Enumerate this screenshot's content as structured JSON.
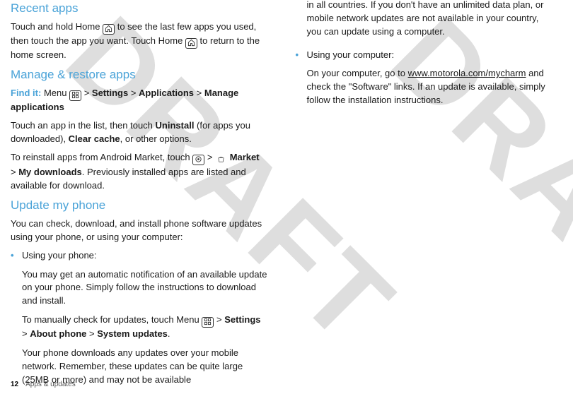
{
  "watermark": "DRAFT",
  "col1": {
    "h_recent": "Recent apps",
    "recent_p1a": "Touch and hold Home ",
    "recent_p1b": " to see the last few apps you used, then touch the app you want. Touch Home ",
    "recent_p1c": " to  return to the home screen.",
    "h_manage": "Manage & restore apps",
    "findit": "Find it:",
    "manage_p1a": " Menu ",
    "manage_p1b": " > ",
    "settings": "Settings",
    "gt": " > ",
    "applications": "Applications",
    "manage_apps": "Manage applications",
    "manage_p2a": "Touch an app in the list, then touch ",
    "uninstall": "Uninstall",
    "manage_p2b": " (for apps you downloaded), ",
    "clearcache": "Clear cache",
    "manage_p2c": ", or other options.",
    "manage_p3a": "To reinstall apps from Android Market, touch ",
    "manage_p3b": " > ",
    "market": "Market",
    "mydownloads": "My downloads",
    "manage_p3c": ". Previously installed apps are listed and available for download.",
    "h_update": "Update my phone",
    "update_p1": "You can check, download, and install phone software updates using your phone, or using your computer:",
    "b1_title": "Using your phone:",
    "b1_p1": "You may get an automatic notification of an available update on your phone. Simply follow the instructions to download and install.",
    "b1_p2a": "To manually check for updates, touch Menu ",
    "b1_p2b": " > ",
    "aboutphone": "About phone",
    "sysupdates": "System updates",
    "b1_p2c": ".",
    "b1_p3": "Your phone downloads any updates over your mobile network. Remember, these updates can be quite large (25MB or more) and may not be available"
  },
  "col2": {
    "cont": "in all countries. If you don't have an unlimited data plan, or mobile network updates are not available in your country, you can update using a computer.",
    "b2_title": "Using your computer:",
    "b2_p1a": "On your computer, go to ",
    "b2_link": "www.motorola.com/mycharm",
    "b2_p1b": " and check the \"Software\" links. If an update is available, simply follow the installation instructions."
  },
  "footer": {
    "page": "12",
    "section": "Apps & updates"
  }
}
